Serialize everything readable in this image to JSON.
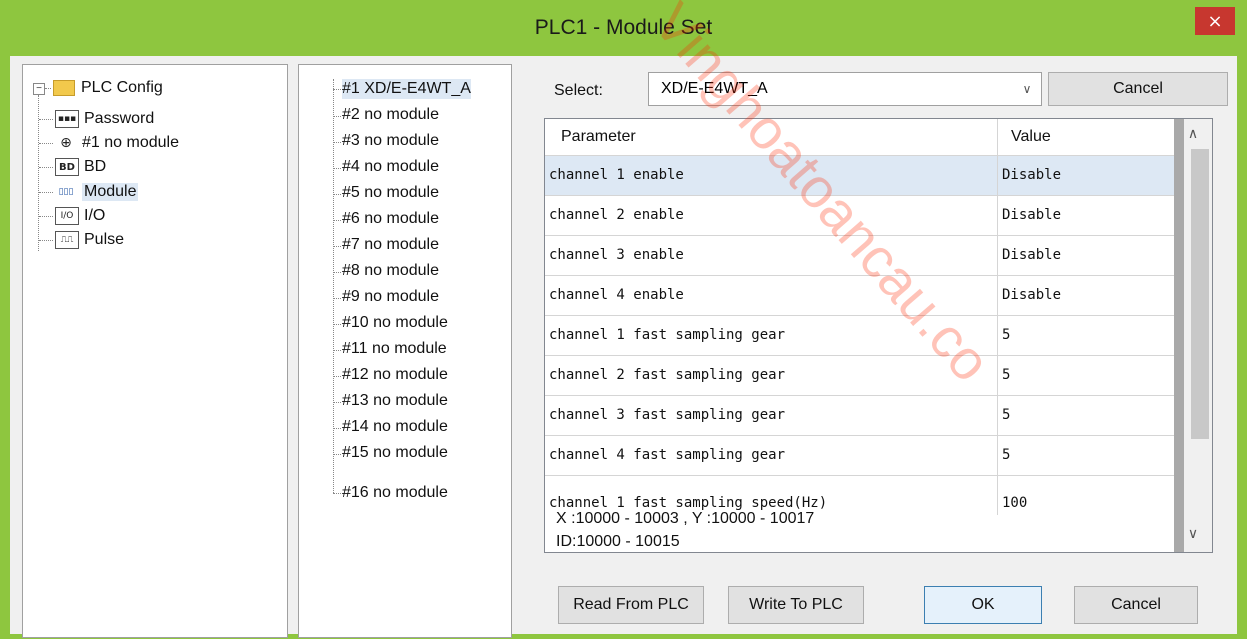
{
  "window": {
    "title": "PLC1 - Module  Set",
    "close_glyph": "×"
  },
  "tree": {
    "root": "PLC Config",
    "items": [
      {
        "icon": "password-icon",
        "icon_text": "▪▪▪",
        "label": "Password"
      },
      {
        "icon": "module-gear-icon",
        "icon_text": "⊕",
        "label": "#1 no module"
      },
      {
        "icon": "bd-icon",
        "icon_text": "BD",
        "label": "BD"
      },
      {
        "icon": "module-icon",
        "icon_text": "▯▯▯",
        "label": "Module"
      },
      {
        "icon": "io-icon",
        "icon_text": "I/O",
        "label": "I/O"
      },
      {
        "icon": "pulse-icon",
        "icon_text": "⎍⎍",
        "label": "Pulse"
      }
    ]
  },
  "modules": [
    "#1 XD/E-E4WT_A",
    "#2 no module",
    "#3 no module",
    "#4 no module",
    "#5 no module",
    "#6 no module",
    "#7 no module",
    "#8 no module",
    "#9 no module",
    "#10 no module",
    "#11 no module",
    "#12 no module",
    "#13 no module",
    "#14 no module",
    "#15 no module",
    "#16 no module"
  ],
  "select": {
    "label": "Select:",
    "value": "XD/E-E4WT_A",
    "arrow": "∨",
    "cancel_label": "Cancel"
  },
  "grid": {
    "headers": [
      "Parameter",
      "Value"
    ],
    "rows": [
      {
        "param": "channel 1 enable",
        "value": "Disable"
      },
      {
        "param": "channel 2 enable",
        "value": "Disable"
      },
      {
        "param": "channel 3 enable",
        "value": "Disable"
      },
      {
        "param": "channel 4 enable",
        "value": "Disable"
      },
      {
        "param": "channel 1 fast sampling gear",
        "value": "5"
      },
      {
        "param": "channel 2 fast sampling gear",
        "value": "5"
      },
      {
        "param": "channel 3 fast sampling gear",
        "value": "5"
      },
      {
        "param": "channel 4 fast sampling gear",
        "value": "5"
      },
      {
        "param": "channel 1 fast sampling speed(Hz)",
        "value": "100"
      }
    ],
    "scroll_up": "∧",
    "scroll_down": "∨"
  },
  "info": {
    "line1": "X :10000 - 10003 , Y :10000 - 10017",
    "line2": "ID:10000 - 10015"
  },
  "buttons": {
    "read": "Read From PLC",
    "write": "Write To PLC",
    "ok": "OK",
    "cancel": "Cancel"
  },
  "watermark": "Vinghoatoancau.co"
}
